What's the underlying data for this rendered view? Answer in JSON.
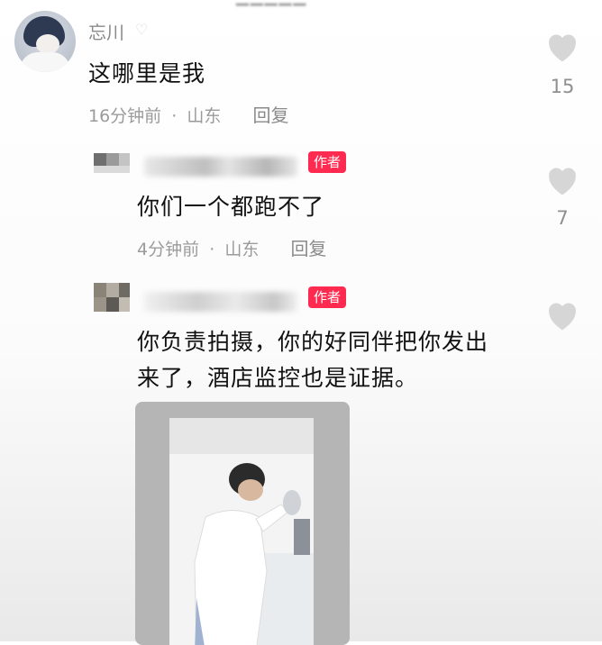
{
  "comments": [
    {
      "username": "忘川",
      "text": "这哪里是我",
      "time": "16分钟前",
      "location": "山东",
      "reply_label": "回复",
      "likes": "15"
    },
    {
      "author_badge": "作者",
      "text": "你们一个都跑不了",
      "time": "4分钟前",
      "location": "山东",
      "reply_label": "回复",
      "likes": "7"
    },
    {
      "author_badge": "作者",
      "text_line1": "你负责拍摄，你的好同伴把你发出",
      "text_line2": "来了，酒店监控也是证据。"
    }
  ],
  "separator": "·",
  "colors": {
    "badge": "#ff2a4f",
    "heart": "#d6d6d6",
    "meta": "#9b9b9b"
  }
}
